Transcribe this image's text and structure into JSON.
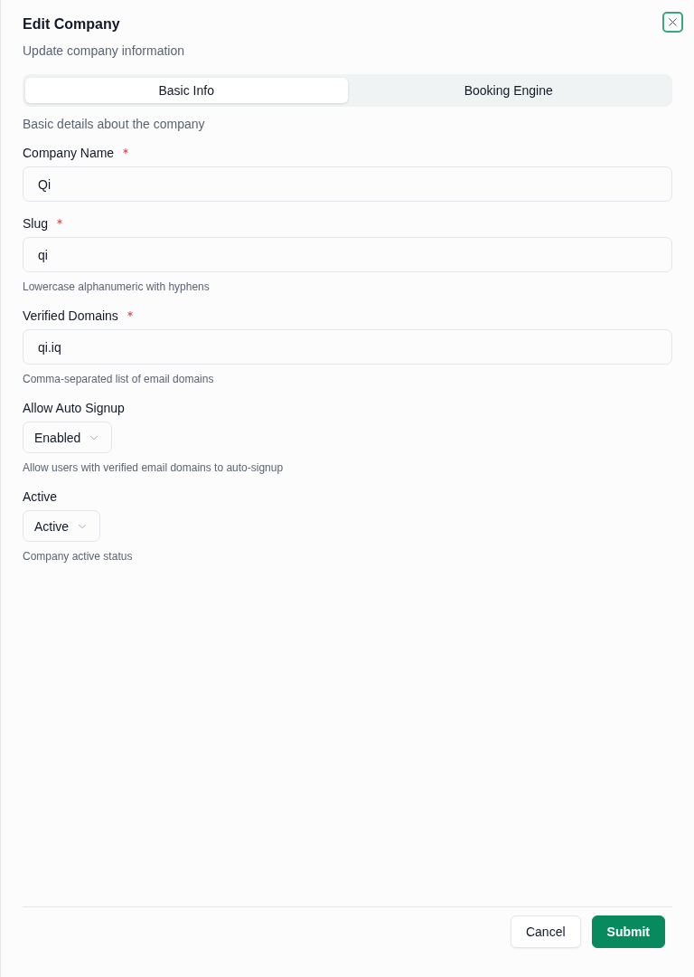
{
  "dialog": {
    "title": "Edit Company",
    "subtitle": "Update company information",
    "close_button": {
      "focused": true
    }
  },
  "tabs": [
    {
      "label": "Basic Info",
      "selected": true
    },
    {
      "label": "Booking Engine",
      "selected": false
    }
  ],
  "section_description": "Basic details about the company",
  "fields": [
    {
      "kind": "text",
      "label": "Company Name",
      "required": true,
      "value": "Qi"
    },
    {
      "kind": "text",
      "label": "Slug",
      "required": true,
      "value": "qi",
      "help": "Lowercase alphanumeric with hyphens"
    },
    {
      "kind": "text",
      "label": "Verified Domains",
      "required": true,
      "value": "qi.iq",
      "help": "Comma-separated list of email domains"
    },
    {
      "kind": "select",
      "label": "Allow Auto Signup",
      "value": "Enabled",
      "help": "Allow users with verified email domains to auto-signup"
    },
    {
      "kind": "select",
      "label": "Active",
      "value": "Active",
      "help": "Company active status"
    }
  ],
  "footer": {
    "buttons": [
      {
        "label": "Cancel",
        "kind": "secondary"
      },
      {
        "label": "Submit",
        "kind": "primary"
      }
    ]
  }
}
